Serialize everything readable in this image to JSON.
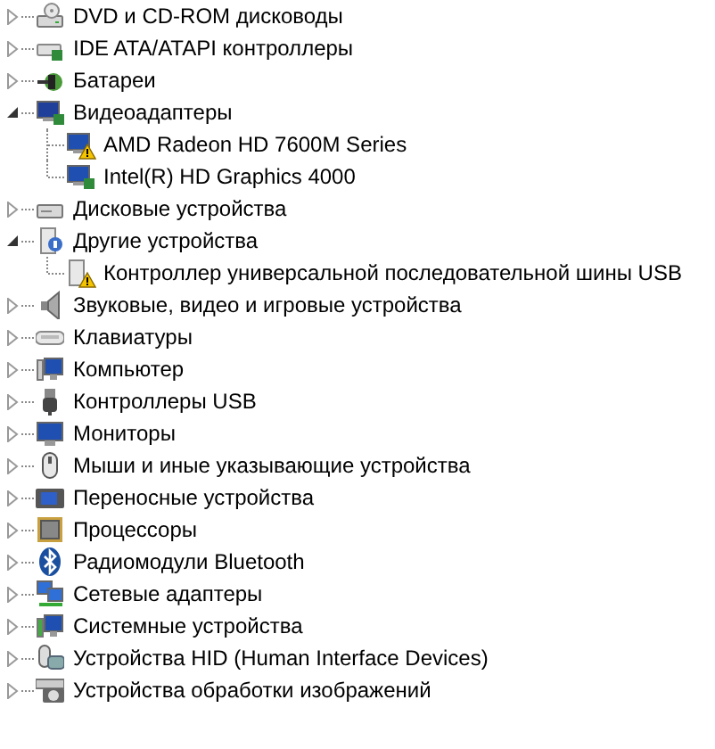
{
  "tree": [
    {
      "label": "DVD и CD-ROM дисководы",
      "expanded": false
    },
    {
      "label": "IDE ATA/ATAPI контроллеры",
      "expanded": false
    },
    {
      "label": "Батареи",
      "expanded": false
    },
    {
      "label": "Видеоадаптеры",
      "expanded": true,
      "children": [
        {
          "label": "AMD Radeon HD 7600M Series",
          "warning": true
        },
        {
          "label": "Intel(R) HD Graphics 4000",
          "warning": false
        }
      ]
    },
    {
      "label": "Дисковые устройства",
      "expanded": false
    },
    {
      "label": "Другие устройства",
      "expanded": true,
      "children": [
        {
          "label": "Контроллер универсальной последовательной шины USB",
          "warning": true
        }
      ]
    },
    {
      "label": "Звуковые, видео и игровые устройства",
      "expanded": false
    },
    {
      "label": "Клавиатуры",
      "expanded": false
    },
    {
      "label": "Компьютер",
      "expanded": false
    },
    {
      "label": "Контроллеры USB",
      "expanded": false
    },
    {
      "label": "Мониторы",
      "expanded": false
    },
    {
      "label": "Мыши и иные указывающие устройства",
      "expanded": false
    },
    {
      "label": "Переносные устройства",
      "expanded": false
    },
    {
      "label": "Процессоры",
      "expanded": false
    },
    {
      "label": "Радиомодули Bluetooth",
      "expanded": false
    },
    {
      "label": "Сетевые адаптеры",
      "expanded": false
    },
    {
      "label": "Системные устройства",
      "expanded": false
    },
    {
      "label": "Устройства HID (Human Interface Devices)",
      "expanded": false
    },
    {
      "label": "Устройства обработки изображений",
      "expanded": false
    }
  ]
}
